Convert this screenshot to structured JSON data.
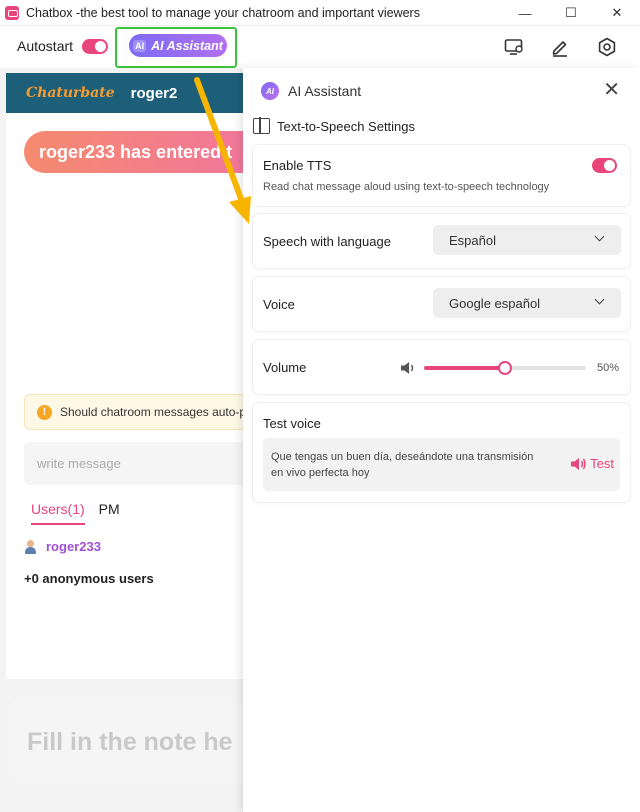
{
  "window": {
    "title": "Chatbox -the best tool to manage your chatroom and important viewers",
    "minimize_glyph": "—",
    "maximize_glyph": "☐",
    "close_glyph": "✕"
  },
  "toolbar": {
    "autostart_label": "Autostart",
    "ai_assistant_label": "AI Assistant",
    "ai_glyph": "AI"
  },
  "chatroom": {
    "platform_logo": "Chaturbate",
    "room_name": "roger2",
    "enter_message": "roger233 has entered t",
    "notice": "Should chatroom messages auto-pla",
    "notice_icon_glyph": "!",
    "write_placeholder": "write message",
    "tabs": [
      {
        "label": "Users(1)",
        "active": true
      },
      {
        "label": "PM",
        "active": false
      }
    ],
    "users": [
      {
        "name": "roger233"
      }
    ],
    "anonymous": "+0 anonymous users",
    "note_placeholder": "Fill in the note he"
  },
  "drawer": {
    "title": "AI Assistant",
    "ai_glyph": "AI",
    "close_glyph": "✕",
    "section_title": "Text-to-Speech Settings",
    "enable_tts": {
      "label": "Enable TTS",
      "description": "Read chat message aloud using text-to-speech technology",
      "on": true
    },
    "language": {
      "label": "Speech with language",
      "selected": "Español"
    },
    "voice": {
      "label": "Voice",
      "selected": "Google español"
    },
    "volume": {
      "label": "Volume",
      "value": 0.5,
      "display": "50%"
    },
    "test_voice": {
      "label": "Test voice",
      "sample_text": "Que tengas un buen día, deseándote una transmisión en vivo perfecta hoy",
      "button_label": "Test"
    }
  },
  "colors": {
    "accent": "#e8457a",
    "ai_gradient_start": "#7d6bf2",
    "ai_gradient_end": "#b06ff0",
    "highlight_box": "#3cc23c",
    "annotation_arrow": "#f7b500",
    "room_header": "#1d5e78"
  }
}
